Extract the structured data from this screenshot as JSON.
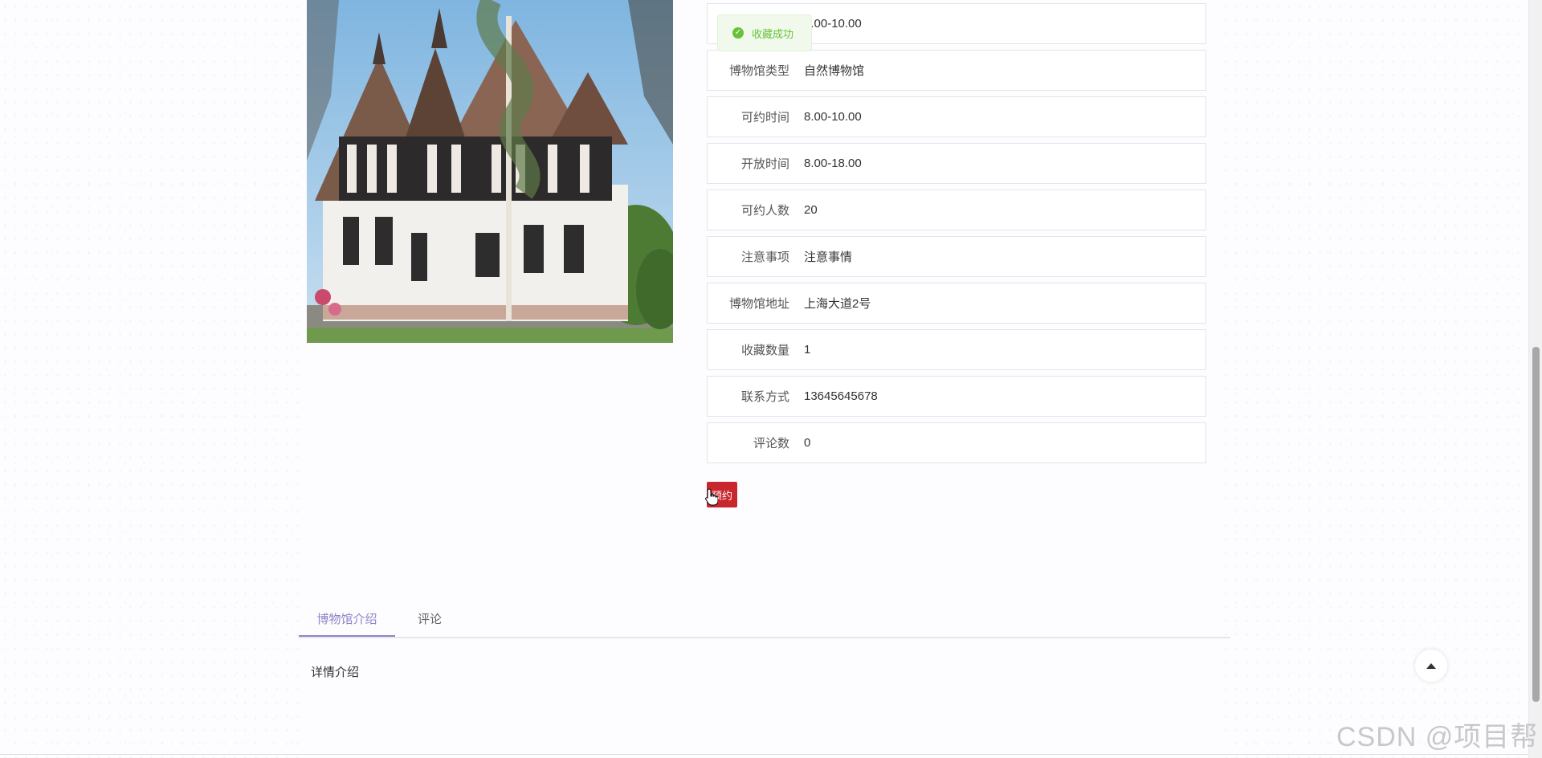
{
  "toast": {
    "text": "收藏成功",
    "icon": "check-circle-icon",
    "color": "#67c23a"
  },
  "details": [
    {
      "label": "",
      "value": "8.00-10.00"
    },
    {
      "label": "博物馆类型",
      "value": "自然博物馆"
    },
    {
      "label": "可约时间",
      "value": "8.00-10.00"
    },
    {
      "label": "开放时间",
      "value": "8.00-18.00"
    },
    {
      "label": "可约人数",
      "value": "20"
    },
    {
      "label": "注意事项",
      "value": "注意事情"
    },
    {
      "label": "博物馆地址",
      "value": "上海大道2号"
    },
    {
      "label": "收藏数量",
      "value": "1"
    },
    {
      "label": "联系方式",
      "value": "13645645678"
    },
    {
      "label": "评论数",
      "value": "0"
    }
  ],
  "book_button": {
    "label": "预约",
    "color": "#c9262d"
  },
  "tabs": [
    {
      "label": "博物馆介绍",
      "active": true
    },
    {
      "label": "评论",
      "active": false
    }
  ],
  "tab_content": "详情介绍",
  "accent_color": "#8d86c9",
  "watermark": "CSDN @项目帮"
}
